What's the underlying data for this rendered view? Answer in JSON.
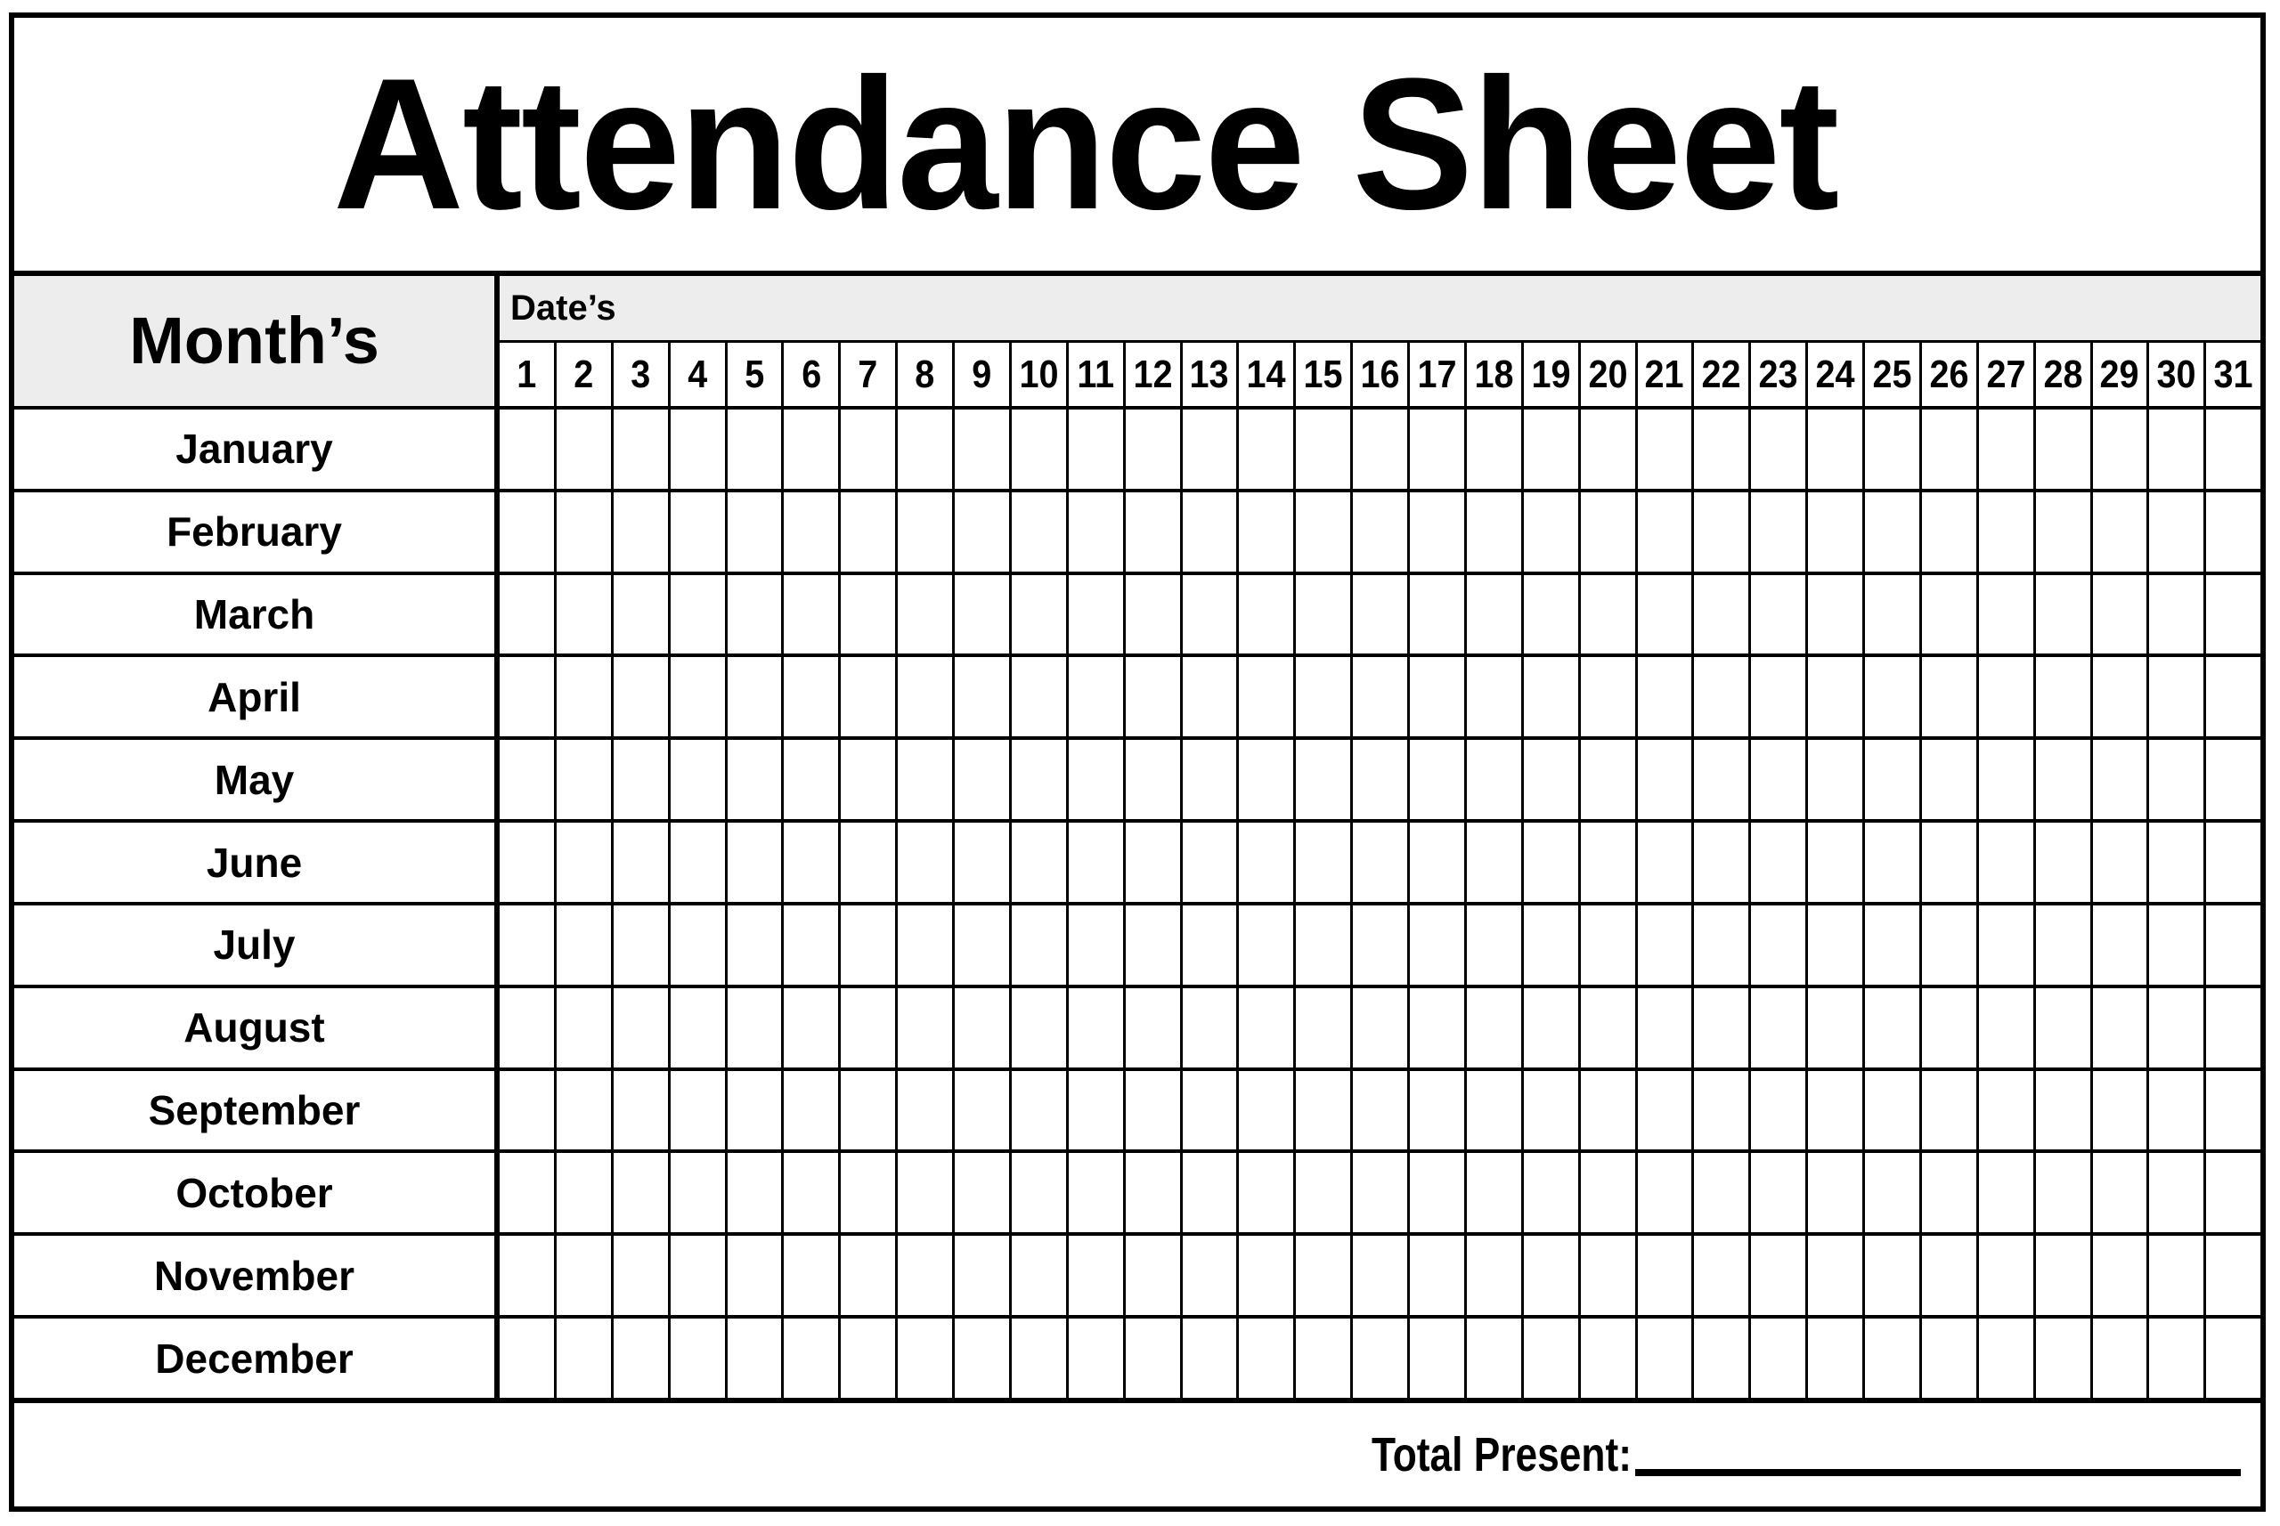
{
  "document": {
    "title": "Attendance Sheet"
  },
  "table": {
    "month_column_header": "Month’s",
    "dates_column_header": "Date’s",
    "days": [
      "1",
      "2",
      "3",
      "4",
      "5",
      "6",
      "7",
      "8",
      "9",
      "10",
      "11",
      "12",
      "13",
      "14",
      "15",
      "16",
      "17",
      "18",
      "19",
      "20",
      "21",
      "22",
      "23",
      "24",
      "25",
      "26",
      "27",
      "28",
      "29",
      "30",
      "31"
    ],
    "months": [
      "January",
      "February",
      "March",
      "April",
      "May",
      "June",
      "July",
      "August",
      "September",
      "October",
      "November",
      "December"
    ]
  },
  "footer": {
    "total_present_label": "Total Present:",
    "total_present_value": ""
  },
  "colors": {
    "header_fill": "#ededed",
    "cell_fill": "#ffffff",
    "border": "#000000",
    "text": "#000000"
  }
}
